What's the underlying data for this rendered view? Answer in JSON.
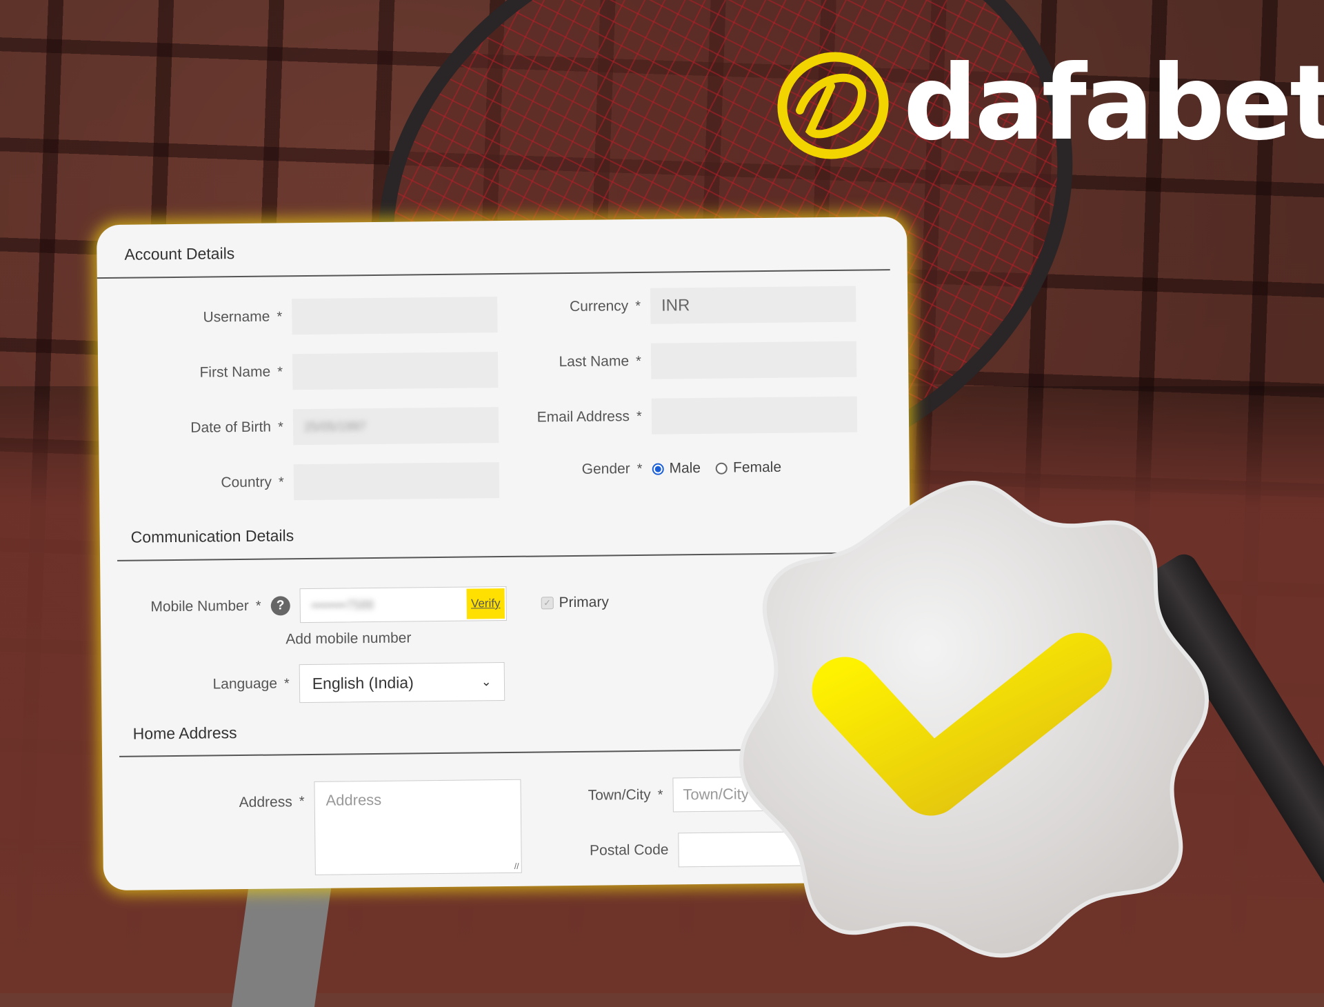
{
  "brand": {
    "name": "dafabet",
    "accent_color": "#ffe000"
  },
  "account_details": {
    "title": "Account Details",
    "fields": {
      "username": {
        "label": "Username",
        "required": "*",
        "value": ""
      },
      "first_name": {
        "label": "First Name",
        "required": "*",
        "value": ""
      },
      "date_of_birth": {
        "label": "Date of Birth",
        "required": "*",
        "value": "25/05/1997"
      },
      "country": {
        "label": "Country",
        "required": "*",
        "value": ""
      },
      "currency": {
        "label": "Currency",
        "required": "*",
        "value": "INR"
      },
      "last_name": {
        "label": "Last Name",
        "required": "*",
        "value": ""
      },
      "email": {
        "label": "Email Address",
        "required": "*",
        "value": ""
      },
      "gender": {
        "label": "Gender",
        "required": "*",
        "options": [
          {
            "label": "Male",
            "selected": true
          },
          {
            "label": "Female",
            "selected": false
          }
        ]
      }
    }
  },
  "communication_details": {
    "title": "Communication Details",
    "mobile": {
      "label": "Mobile Number",
      "required": "*",
      "help_icon": "?",
      "value": "••••••••7588",
      "verify_label": "Verify",
      "primary_label": "Primary",
      "primary_checked": true,
      "add_label": "Add mobile number"
    },
    "language": {
      "label": "Language",
      "required": "*",
      "selected": "English (India)"
    }
  },
  "home_address": {
    "title": "Home Address",
    "address": {
      "label": "Address",
      "required": "*",
      "placeholder": "Address"
    },
    "town_city": {
      "label": "Town/City",
      "required": "*",
      "placeholder": "Town/City"
    },
    "postal_code": {
      "label": "Postal Code",
      "value": ""
    }
  },
  "badge": {
    "icon": "check-badge-icon",
    "check_color": "#f2d400"
  }
}
